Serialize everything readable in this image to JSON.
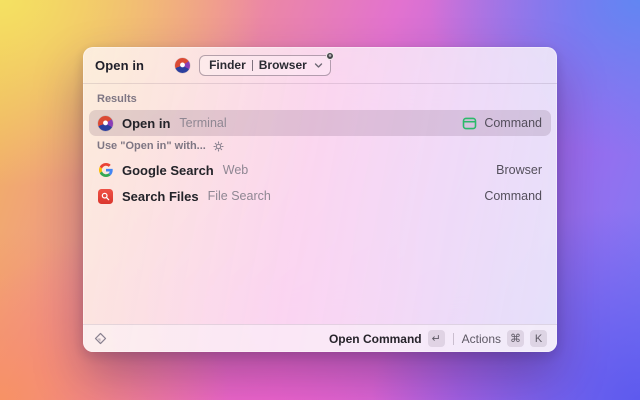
{
  "header": {
    "title": "Open in",
    "dropdown": {
      "left": "Finder",
      "right": "Browser"
    }
  },
  "sections": {
    "results": {
      "label": "Results",
      "row": {
        "title": "Open in",
        "subtitle": "Terminal",
        "accessory": "Command"
      }
    },
    "use_with": {
      "label": "Use \"Open in\" with...",
      "rows": [
        {
          "title": "Google Search",
          "subtitle": "Web",
          "accessory": "Browser"
        },
        {
          "title": "Search Files",
          "subtitle": "File Search",
          "accessory": "Command"
        }
      ]
    }
  },
  "footer": {
    "primary_label": "Open Command",
    "primary_key": "↵",
    "actions_label": "Actions",
    "actions_keys": [
      "⌘",
      "K"
    ]
  },
  "icons": {
    "extension": "open-in-circle-icon",
    "terminal_accessory": "terminal-window-icon",
    "google": "google-g-icon",
    "file_search": "file-search-icon",
    "section_gear": "gear-icon",
    "footer_logo": "raycast-diamond-icon",
    "dropdown_chevron": "chevron-down-icon"
  },
  "colors": {
    "terminal_icon_green": "#2bb96a",
    "file_search_red": "#e2443a",
    "selected_row_tint": "rgba(96,66,96,0.17)"
  }
}
